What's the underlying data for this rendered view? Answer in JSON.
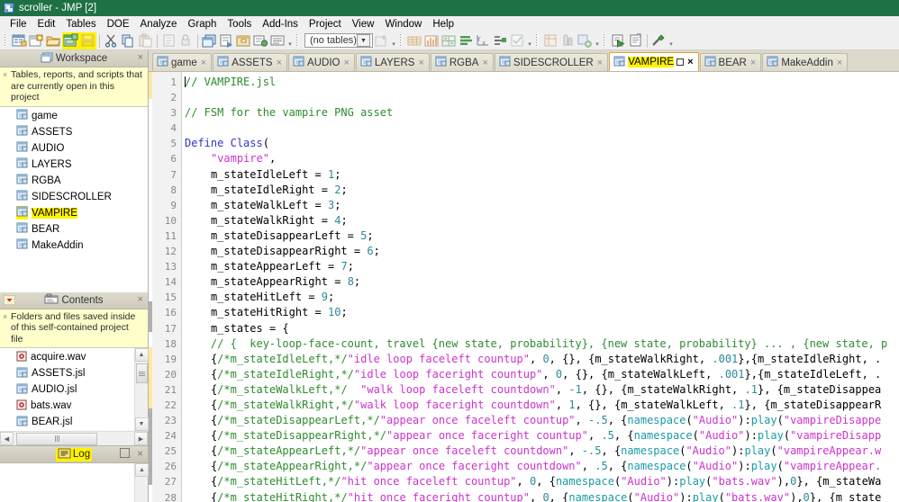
{
  "window": {
    "title": "scroller - JMP [2]",
    "icon": "jmp-app-icon"
  },
  "menubar": {
    "items": [
      {
        "label": "File"
      },
      {
        "label": "Edit"
      },
      {
        "label": "Tables"
      },
      {
        "label": "DOE"
      },
      {
        "label": "Analyze"
      },
      {
        "label": "Graph"
      },
      {
        "label": "Tools"
      },
      {
        "label": "Add-Ins"
      },
      {
        "label": "Project"
      },
      {
        "label": "View"
      },
      {
        "label": "Window"
      },
      {
        "label": "Help"
      }
    ]
  },
  "toolbar": {
    "table_selector_value": "(no tables)",
    "highlight_color": "#fff200",
    "buttons": [
      {
        "name": "new-data-table-icon"
      },
      {
        "name": "new-project-icon"
      },
      {
        "name": "open-file-icon"
      },
      {
        "name": "save-project-icon"
      },
      {
        "name": "save-icon"
      },
      {
        "name": "cut-icon"
      },
      {
        "name": "copy-icon"
      },
      {
        "name": "paste-icon"
      },
      {
        "name": "journal-icon"
      },
      {
        "name": "lock-icon"
      },
      {
        "name": "new-window-icon"
      },
      {
        "name": "report-icon"
      },
      {
        "name": "archive-icon"
      },
      {
        "name": "preferences-icon"
      },
      {
        "name": "list-icon"
      }
    ]
  },
  "workspace": {
    "panel_title": "Workspace",
    "panel_icon": "windows-stack-icon",
    "tip": "Tables, reports, and scripts that are currently open in this project",
    "items": [
      {
        "label": "game",
        "highlighted": false
      },
      {
        "label": "ASSETS",
        "highlighted": false
      },
      {
        "label": "AUDIO",
        "highlighted": false
      },
      {
        "label": "LAYERS",
        "highlighted": false
      },
      {
        "label": "RGBA",
        "highlighted": false
      },
      {
        "label": "SIDESCROLLER",
        "highlighted": false
      },
      {
        "label": "VAMPIRE",
        "highlighted": true
      },
      {
        "label": "BEAR",
        "highlighted": false
      },
      {
        "label": "MakeAddin",
        "highlighted": false
      }
    ]
  },
  "contents": {
    "panel_title": "Contents",
    "panel_icon": "contents-icon",
    "tip": "Folders and files saved inside of this self-contained project file",
    "items": [
      {
        "label": "acquire.wav",
        "icon": "wav-file-icon"
      },
      {
        "label": "ASSETS.jsl",
        "icon": "jsl-file-icon"
      },
      {
        "label": "AUDIO.jsl",
        "icon": "jsl-file-icon"
      },
      {
        "label": "bats.wav",
        "icon": "wav-file-icon"
      },
      {
        "label": "BEAR.jsl",
        "icon": "jsl-file-icon"
      }
    ]
  },
  "log": {
    "panel_title": "Log",
    "panel_icon": "log-icon",
    "content": ""
  },
  "tabs": [
    {
      "label": "game",
      "active": false,
      "highlighted": false
    },
    {
      "label": "ASSETS",
      "active": false,
      "highlighted": false
    },
    {
      "label": "AUDIO",
      "active": false,
      "highlighted": false
    },
    {
      "label": "LAYERS",
      "active": false,
      "highlighted": false
    },
    {
      "label": "RGBA",
      "active": false,
      "highlighted": false
    },
    {
      "label": "SIDESCROLLER",
      "active": false,
      "highlighted": false
    },
    {
      "label": "VAMPIRE",
      "active": true,
      "highlighted": true
    },
    {
      "label": "BEAR",
      "active": false,
      "highlighted": false
    },
    {
      "label": "MakeAddin",
      "active": false,
      "highlighted": false
    }
  ],
  "editor": {
    "active_file": "VAMPIRE.jsl",
    "line_numbers": [
      1,
      2,
      3,
      4,
      5,
      6,
      7,
      8,
      9,
      10,
      11,
      12,
      13,
      14,
      15,
      16,
      17,
      18,
      19,
      20,
      21,
      22,
      23,
      24,
      25,
      26,
      27,
      28
    ],
    "lines": [
      "// VAMPIRE.jsl",
      "",
      "// FSM for the vampire PNG asset",
      "",
      "Define Class(",
      "    \"vampire\",",
      "    m_stateIdleLeft = 1;",
      "    m_stateIdleRight = 2;",
      "    m_stateWalkLeft = 3;",
      "    m_stateWalkRight = 4;",
      "    m_stateDisappearLeft = 5;",
      "    m_stateDisappearRight = 6;",
      "    m_stateAppearLeft = 7;",
      "    m_stateAppearRight = 8;",
      "    m_stateHitLeft = 9;",
      "    m_stateHitRight = 10;",
      "    m_states = {",
      "    // {  key-loop-face-count, travel {new state, probability}, {new state, probability} ... , {new state, p",
      "    {/*m_stateIdleLeft,*/\"idle loop faceleft countup\", 0, {}, {m_stateWalkRight, .001},{m_stateIdleRight, .",
      "    {/*m_stateIdleRight,*/\"idle loop faceright countup\", 0, {}, {m_stateWalkLeft, .001},{m_stateIdleLeft, .",
      "    {/*m_stateWalkLeft,*/  \"walk loop faceleft countdown\", -1, {}, {m_stateWalkRight, .1}, {m_stateDisappea",
      "    {/*m_stateWalkRight,*/\"walk loop faceright countdown\", 1, {}, {m_stateWalkLeft, .1}, {m_stateDisappearR",
      "    {/*m_stateDisappearLeft,*/\"appear once faceleft countup\", -.5, {namespace(\"Audio\"):play(\"vampireDisappe",
      "    {/*m_stateDisappearRight,*/\"appear once faceright countup\", .5, {namespace(\"Audio\"):play(\"vampireDisapp",
      "    {/*m_stateAppearLeft,*/\"appear once faceleft countdown\", -.5, {namespace(\"Audio\"):play(\"vampireAppear.w",
      "    {/*m_stateAppearRight,*/\"appear once faceright countdown\", .5, {namespace(\"Audio\"):play(\"vampireAppear.",
      "    {/*m_stateHitLeft,*/\"hit once faceleft countup\", 0, {namespace(\"Audio\"):play(\"bats.wav\"),0}, {m_stateWa",
      "    {/*m_stateHitRight,*/\"hit once faceright countup\", 0, {namespace(\"Audio\"):play(\"bats.wav\"),0}, {m_state"
    ]
  }
}
